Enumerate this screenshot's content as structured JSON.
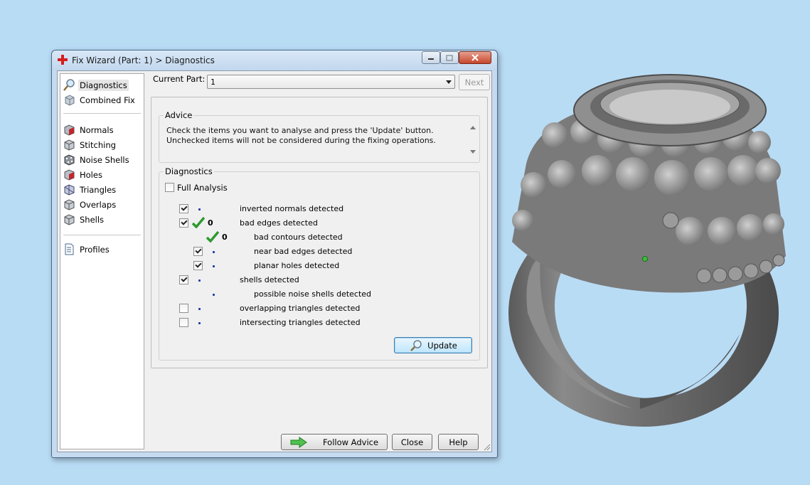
{
  "window": {
    "title": "Fix Wizard (Part: 1) > Diagnostics"
  },
  "nav": {
    "items": [
      {
        "label": "Diagnostics",
        "icon": "magnifier-icon",
        "selected": true
      },
      {
        "label": "Combined Fix",
        "icon": "cube-icon"
      },
      {
        "label": "Normals",
        "icon": "normals-cube-icon"
      },
      {
        "label": "Stitching",
        "icon": "stitching-cube-icon"
      },
      {
        "label": "Noise Shells",
        "icon": "noise-shells-icon"
      },
      {
        "label": "Holes",
        "icon": "holes-cube-icon"
      },
      {
        "label": "Triangles",
        "icon": "triangles-cube-icon"
      },
      {
        "label": "Overlaps",
        "icon": "overlaps-cube-icon"
      },
      {
        "label": "Shells",
        "icon": "shells-cube-icon"
      },
      {
        "label": "Profiles",
        "icon": "document-icon"
      }
    ]
  },
  "header": {
    "current_part_label": "Current Part:",
    "current_part_value": "1",
    "next_label": "Next"
  },
  "advice": {
    "title": "Advice",
    "text": "Check the items you want to analyse and press the 'Update' button. Unchecked items will not be considered during the fixing operations."
  },
  "diagnostics": {
    "title": "Diagnostics",
    "full_analysis_label": "Full Analysis",
    "full_analysis_checked": false,
    "rows": [
      {
        "label": "inverted normals detected",
        "checked": true,
        "result": ""
      },
      {
        "label": "bad edges detected",
        "checked": true,
        "result": "0"
      },
      {
        "label": "bad contours detected",
        "checked": null,
        "result": "0"
      },
      {
        "label": "near bad edges detected",
        "checked": true,
        "result": ""
      },
      {
        "label": "planar holes detected",
        "checked": true,
        "result": ""
      },
      {
        "label": "shells detected",
        "checked": true,
        "result": ""
      },
      {
        "label": "possible noise shells detected",
        "checked": null,
        "result": ""
      },
      {
        "label": "overlapping triangles detected",
        "checked": false,
        "result": ""
      },
      {
        "label": "intersecting triangles detected",
        "checked": false,
        "result": ""
      }
    ],
    "update_label": "Update"
  },
  "footer": {
    "follow_advice_label": "Follow Advice",
    "close_label": "Close",
    "help_label": "Help"
  },
  "colors": {
    "desktop_bg": "#b9dcf5",
    "check_green": "#2e9a2e",
    "close_red": "#c7452b"
  }
}
